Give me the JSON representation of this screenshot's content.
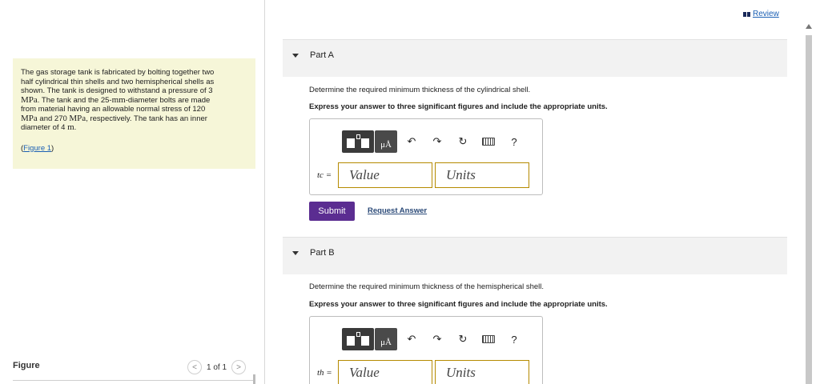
{
  "problem": {
    "line1": "The gas storage tank is fabricated by bolting together two",
    "line2": "half cylindrical thin shells and two hemispherical shells as",
    "line3_pre": "shown. The tank is designed to withstand a pressure of 3",
    "line4_unit": "MPa",
    "line4_rest": ". The tank and the 25-",
    "line4_unit2": "mm",
    "line4_end": "-diameter bolts are made",
    "line5": "from material having an allowable normal stress of 120",
    "line6_unit": "MPa",
    "line6_mid": " and 270 ",
    "line6_unit2": "MPa",
    "line6_end": ", respectively. The tank has an inner",
    "line7_pre": "diameter of 4 ",
    "line7_unit": "m",
    "line7_end": ".",
    "figure_link_open": "(",
    "figure_link": "Figure 1",
    "figure_link_close": ")"
  },
  "figure_panel": {
    "title": "Figure",
    "pager_text": "1 of 1",
    "prev": "<",
    "next": ">"
  },
  "header": {
    "review_label": "Review"
  },
  "parts": [
    {
      "title": "Part A",
      "question": "Determine the required minimum thickness of the cylindrical shell.",
      "instruction": "Express your answer to three significant figures and include the appropriate units.",
      "var_label": "tc =",
      "value_placeholder": "Value",
      "units_placeholder": "Units",
      "submit_label": "Submit",
      "request_label": "Request Answer"
    },
    {
      "title": "Part B",
      "question": "Determine the required minimum thickness of the hemispherical shell.",
      "instruction": "Express your answer to three significant figures and include the appropriate units.",
      "var_label": "th =",
      "value_placeholder": "Value",
      "units_placeholder": "Units"
    }
  ],
  "toolbar": {
    "units_symbol": "μÅ",
    "undo": "↶",
    "redo": "↷",
    "reset": "↻",
    "help": "?"
  },
  "colors": {
    "problem_bg": "#f6f6d8",
    "submit_bg": "#5b2d91",
    "link": "#1a5fb4",
    "field_border": "#b58a00"
  },
  "icons": [
    "templates-icon",
    "units-icon",
    "undo-icon",
    "redo-icon",
    "reset-icon",
    "keyboard-icon",
    "help-icon",
    "review-icon",
    "caret-down-icon",
    "chevron-left-icon",
    "chevron-right-icon"
  ]
}
